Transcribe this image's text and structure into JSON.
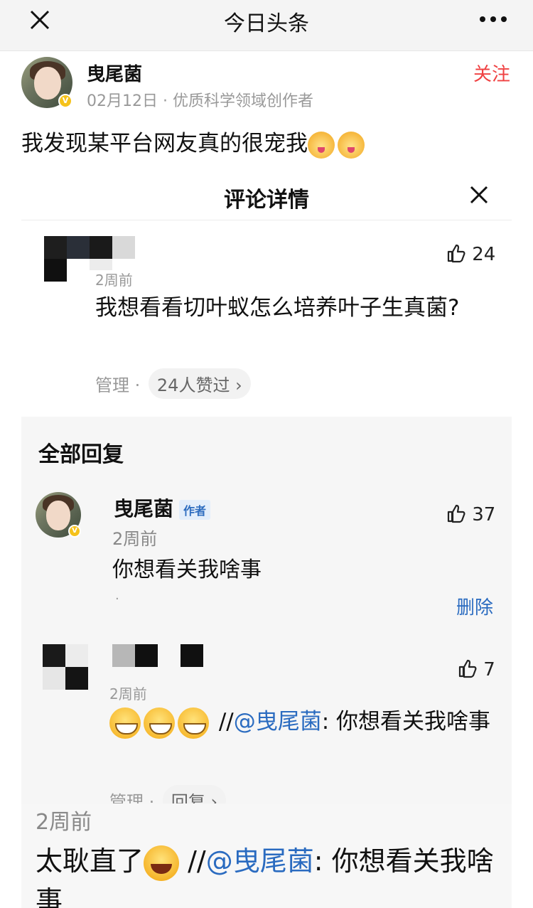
{
  "topbar": {
    "title": "今日头条"
  },
  "author": {
    "name": "曳尾菌",
    "meta": "02月12日 · 优质科学领域创作者",
    "follow_label": "关注"
  },
  "post": {
    "text": "我发现某平台网友真的很宠我"
  },
  "sheet": {
    "title": "评论详情"
  },
  "comment": {
    "time": "2周前",
    "likes": "24",
    "text": "我想看看切叶蚁怎么培养叶子生真菌?",
    "manage": "管理",
    "liked_by": "24人赞过 ›"
  },
  "replies": {
    "heading": "全部回复",
    "items": [
      {
        "name": "曳尾菌",
        "tag": "作者",
        "time": "2周前",
        "likes": "37",
        "text": "你想看关我啥事",
        "dot": "·",
        "delete": "删除"
      },
      {
        "time": "2周前",
        "likes": "7",
        "prefix": " //",
        "mention": "@曳尾菌",
        "text": ": 你想看关我啥事",
        "manage": "管理 ·",
        "reply": "回复 ›"
      }
    ]
  },
  "bottom": {
    "time": "2周前",
    "text_before": "太耿直了",
    "prefix": " //",
    "mention": "@曳尾菌",
    "text": ": 你想看关我啥事"
  },
  "icons": {
    "close": "close-icon",
    "more": "more-icon",
    "thumb": "thumbs-up-icon",
    "verified": "verified-badge-icon"
  },
  "colors": {
    "accent_red": "#f04142",
    "link_blue": "#2a6bc0",
    "muted": "#999999"
  }
}
